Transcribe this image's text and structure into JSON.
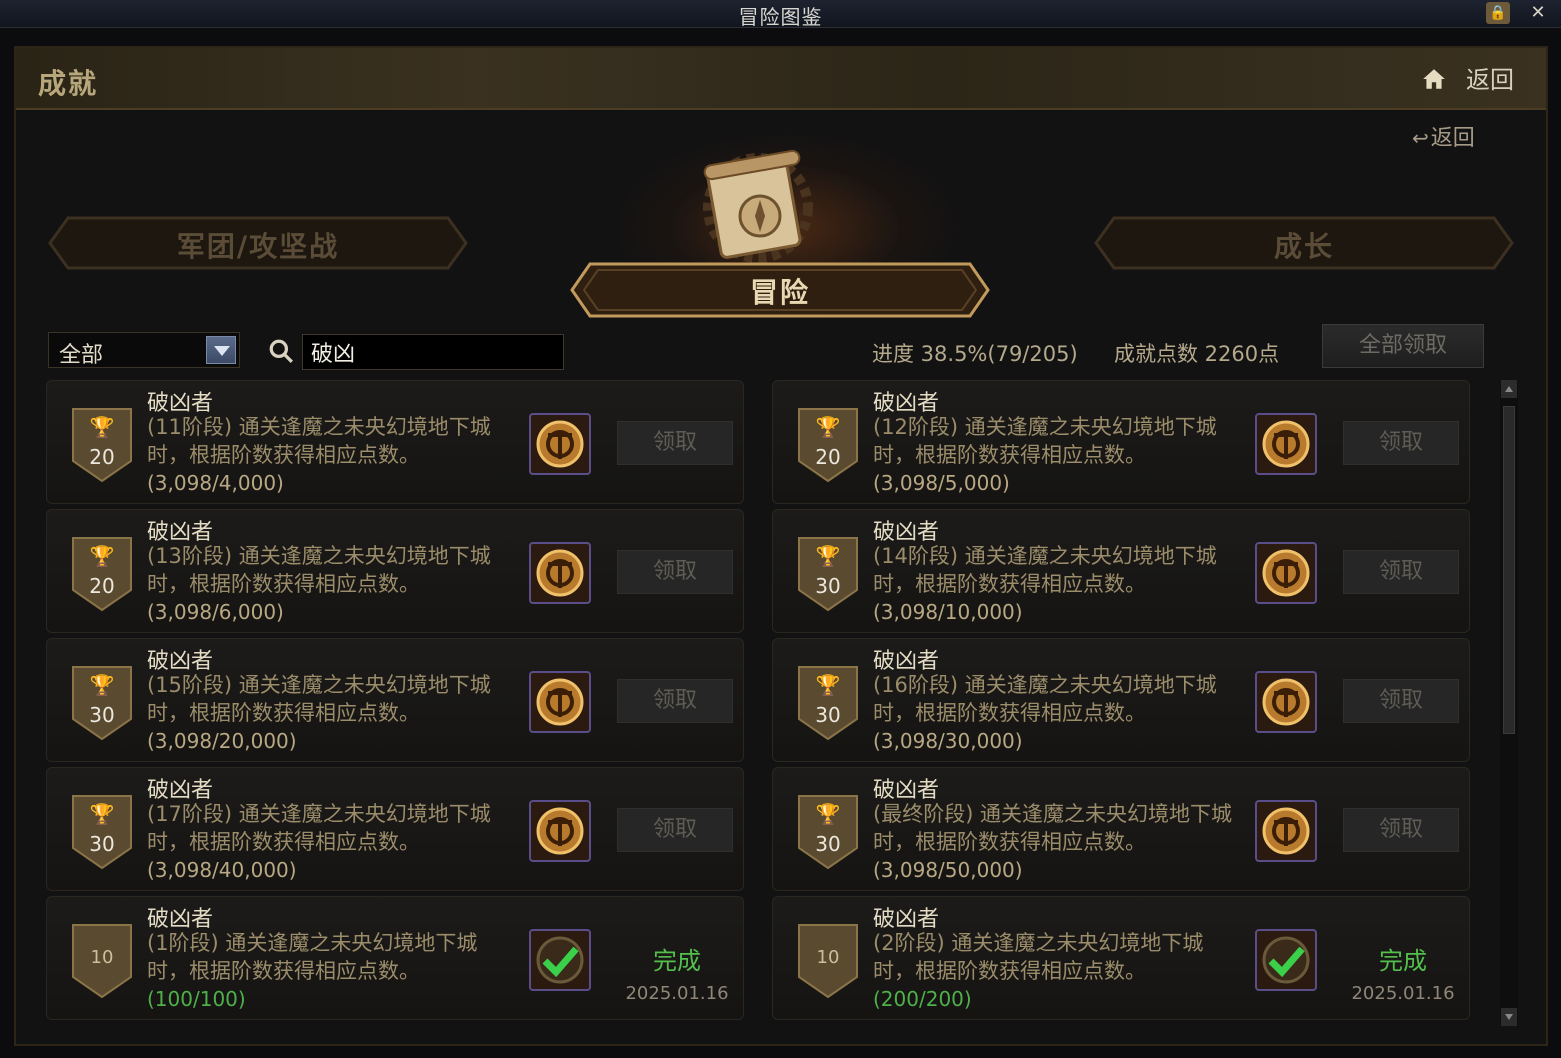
{
  "window": {
    "title": "冒险图鉴"
  },
  "header": {
    "title": "成就",
    "back_label": "返回"
  },
  "sub_back_label": "返回",
  "categories": {
    "left": "军团/攻坚战",
    "center": "冒险",
    "right": "成长"
  },
  "filter": {
    "selected": "全部"
  },
  "search": {
    "value": "破凶"
  },
  "progress_text": "进度 38.5%(79/205)",
  "points_text": "成就点数 2260点",
  "claim_all_label": "全部领取",
  "achievements": [
    {
      "name": "破凶者",
      "desc": "(11阶段) 通关逢魔之未央幻境地下城时，根据阶数获得相应点数。",
      "count": "(3,098/4,000)",
      "points": "20",
      "claim_label": "领取"
    },
    {
      "name": "破凶者",
      "desc": "(12阶段) 通关逢魔之未央幻境地下城时，根据阶数获得相应点数。",
      "count": "(3,098/5,000)",
      "points": "20",
      "claim_label": "领取"
    },
    {
      "name": "破凶者",
      "desc": "(13阶段) 通关逢魔之未央幻境地下城时，根据阶数获得相应点数。",
      "count": "(3,098/6,000)",
      "points": "20",
      "claim_label": "领取"
    },
    {
      "name": "破凶者",
      "desc": "(14阶段) 通关逢魔之未央幻境地下城时，根据阶数获得相应点数。",
      "count": "(3,098/10,000)",
      "points": "30",
      "claim_label": "领取"
    },
    {
      "name": "破凶者",
      "desc": "(15阶段) 通关逢魔之未央幻境地下城时，根据阶数获得相应点数。",
      "count": "(3,098/20,000)",
      "points": "30",
      "claim_label": "领取"
    },
    {
      "name": "破凶者",
      "desc": "(16阶段) 通关逢魔之未央幻境地下城时，根据阶数获得相应点数。",
      "count": "(3,098/30,000)",
      "points": "30",
      "claim_label": "领取"
    },
    {
      "name": "破凶者",
      "desc": "(17阶段) 通关逢魔之未央幻境地下城时，根据阶数获得相应点数。",
      "count": "(3,098/40,000)",
      "points": "30",
      "claim_label": "领取"
    },
    {
      "name": "破凶者",
      "desc": "(最终阶段) 通关逢魔之未央幻境地下城时，根据阶数获得相应点数。",
      "count": "(3,098/50,000)",
      "points": "30",
      "claim_label": "领取"
    },
    {
      "name": "破凶者",
      "desc": "(1阶段) 通关逢魔之未央幻境地下城时，根据阶数获得相应点数。",
      "count": "(100/100)",
      "points": "10",
      "status": "完成",
      "date": "2025.01.16"
    },
    {
      "name": "破凶者",
      "desc": "(2阶段) 通关逢魔之未央幻境地下城时，根据阶数获得相应点数。",
      "count": "(200/200)",
      "points": "10",
      "status": "完成",
      "date": "2025.01.16"
    }
  ],
  "icons": {
    "home": "home-icon",
    "search": "search-icon",
    "trophy": "trophy-icon",
    "reward": "reward-emblem-icon",
    "check": "check-icon"
  },
  "colors": {
    "accent": "#c9b98f",
    "complete": "#53c04b"
  }
}
